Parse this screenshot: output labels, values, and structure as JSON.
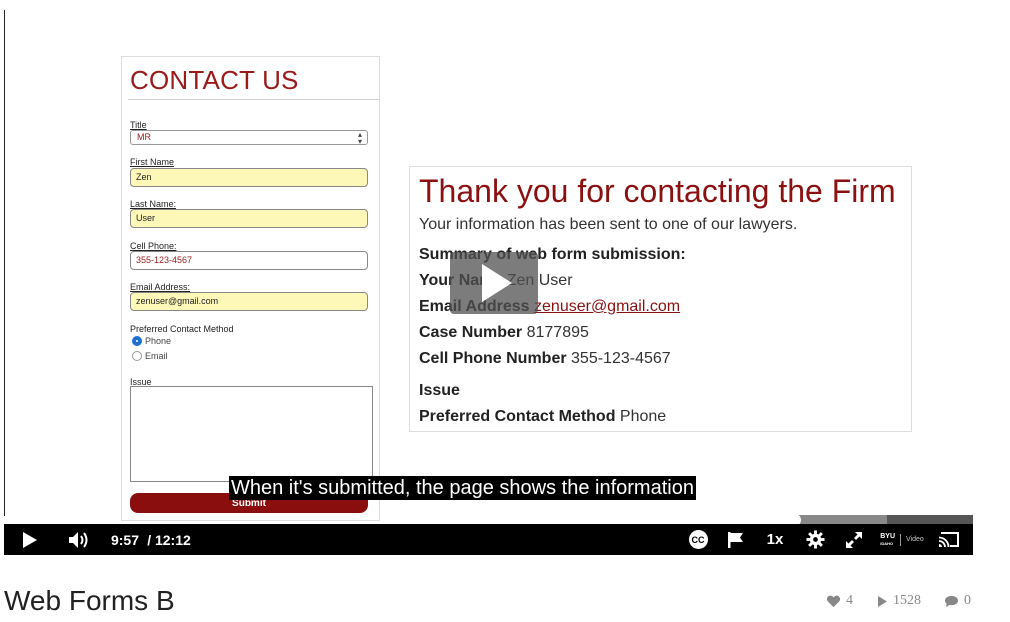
{
  "form": {
    "title": "CONTACT US",
    "title_label": "Title",
    "title_value": "MR",
    "first_name_label": "First Name",
    "first_name_value": "Zen",
    "last_name_label": "Last Name:",
    "last_name_value": "User",
    "cell_phone_label": "Cell Phone:",
    "cell_phone_value": "355-123-4567",
    "email_label": "Email Address:",
    "email_value": "zenuser@gmail.com",
    "contact_method_label": "Preferred Contact Method",
    "contact_options": [
      "Phone",
      "Email"
    ],
    "issue_label": "Issue",
    "submit_label": "Submit"
  },
  "thanks": {
    "title": "Thank you for contacting  the Firm",
    "subtitle": "Your information has been sent to one of our lawyers.",
    "summary_heading": "Summary of web form submission:",
    "name_label": "Your Name",
    "name_value": "Zen User",
    "email_label": "Email Address",
    "email_value": "zenuser@gmail.com",
    "case_label": "Case Number",
    "case_value": "8177895",
    "phone_label": "Cell Phone Number",
    "phone_value": "355-123-4567",
    "issue_label": "Issue",
    "method_label": "Preferred Contact Method",
    "method_value": "Phone"
  },
  "player": {
    "caption": "When it's submitted, the page shows the information",
    "current_time": "9:57",
    "duration": "/ 12:12",
    "speed": "1x",
    "cc_label": "CC",
    "brand_top": "BYU",
    "brand_bottom": "IDAHO",
    "brand_video": "Video",
    "icons": [
      "play-icon",
      "volume-icon",
      "cc-icon",
      "flag-icon",
      "gear-icon",
      "fullscreen-icon",
      "cast-icon"
    ],
    "progress_fraction": 0.815
  },
  "video": {
    "title": "Web Forms B",
    "likes": "4",
    "plays": "1528",
    "comments": "0"
  }
}
